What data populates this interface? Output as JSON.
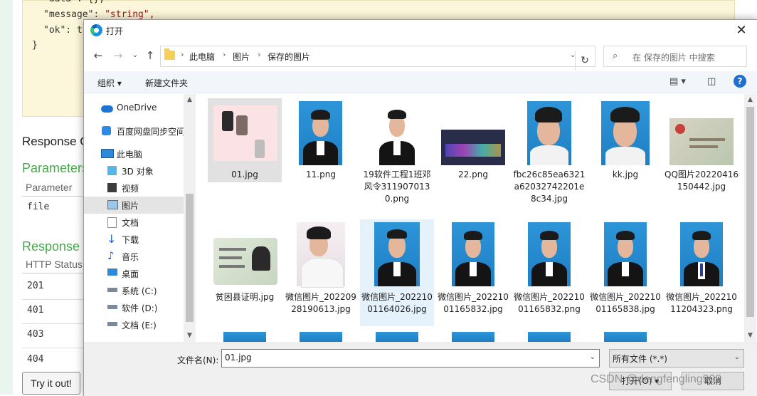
{
  "background": {
    "code_lines": [
      {
        "key": "\"data\": {},",
        "str": ""
      },
      {
        "key": "\"message\": ",
        "str": "\"string\","
      },
      {
        "key": "\"ok\": tr",
        "str": ""
      },
      {
        "key": "}",
        "str": ""
      }
    ],
    "response_heading": "Response C",
    "parameters_heading": "Parameters",
    "parameter_col": "Parameter",
    "parameter_value": "file",
    "response_messages_heading": "Response I",
    "http_status_col": "HTTP Status",
    "status_codes": [
      "201",
      "401",
      "403",
      "404"
    ],
    "try_button": "Try it out!"
  },
  "dialog": {
    "title": "打开",
    "close": "✕",
    "breadcrumbs": [
      "此电脑",
      "图片",
      "保存的图片"
    ],
    "search_placeholder": "在 保存的图片 中搜索",
    "toolbar": {
      "organize": "组织 ▾",
      "new_folder": "新建文件夹"
    },
    "sidebar": [
      {
        "label": "OneDrive",
        "icon": "cloud-icon"
      },
      {
        "label": "百度网盘同步空间",
        "icon": "baidu-netdisk-icon"
      },
      {
        "label": "此电脑",
        "icon": "computer-icon"
      },
      {
        "label": "3D 对象",
        "icon": "3d-objects-icon"
      },
      {
        "label": "视频",
        "icon": "video-icon"
      },
      {
        "label": "图片",
        "icon": "pictures-icon",
        "selected": true
      },
      {
        "label": "文档",
        "icon": "documents-icon"
      },
      {
        "label": "下载",
        "icon": "download-icon"
      },
      {
        "label": "音乐",
        "icon": "music-icon"
      },
      {
        "label": "桌面",
        "icon": "desktop-icon"
      },
      {
        "label": "系统 (C:)",
        "icon": "drive-c-icon"
      },
      {
        "label": "软件 (D:)",
        "icon": "drive-d-icon"
      },
      {
        "label": "文档 (E:)",
        "icon": "drive-e-icon"
      }
    ],
    "files": [
      {
        "name": "01.jpg",
        "kind": "phone-screens",
        "selected": true
      },
      {
        "name": "11.png",
        "kind": "portrait-blue"
      },
      {
        "name": "19软件工程1班邓风令3119070130.png",
        "kind": "portrait-white"
      },
      {
        "name": "22.png",
        "kind": "dark-banner"
      },
      {
        "name": "fbc26c85ea6321a62032742201e8c34.jpg",
        "kind": "face-blue"
      },
      {
        "name": "kk.jpg",
        "kind": "face-blue"
      },
      {
        "name": "QQ图片20220416150442.jpg",
        "kind": "id-card"
      },
      {
        "name": "贫困县证明.jpg",
        "kind": "id-card-front"
      },
      {
        "name": "微信图片_20220928190613.jpg",
        "kind": "casual-photo"
      },
      {
        "name": "微信图片_20221001164026.jpg",
        "kind": "portrait-blue",
        "hover": true
      },
      {
        "name": "微信图片_20221001165832.jpg",
        "kind": "portrait-blue"
      },
      {
        "name": "微信图片_20221001165832.png",
        "kind": "portrait-blue"
      },
      {
        "name": "微信图片_20221001165838.jpg",
        "kind": "portrait-blue"
      },
      {
        "name": "微信图片_20221011204323.png",
        "kind": "portrait-blue-tie"
      }
    ],
    "filename_label": "文件名(N):",
    "filename_value": "01.jpg",
    "filter_value": "所有文件 (*.*)",
    "open_button": "打开(O)",
    "cancel_button": "取消",
    "colors": {
      "selection": "#e1e1e1",
      "hover": "#e5f1fb",
      "accent": "#1e6fd0"
    }
  },
  "watermark": "CSDN @dengfengling999"
}
